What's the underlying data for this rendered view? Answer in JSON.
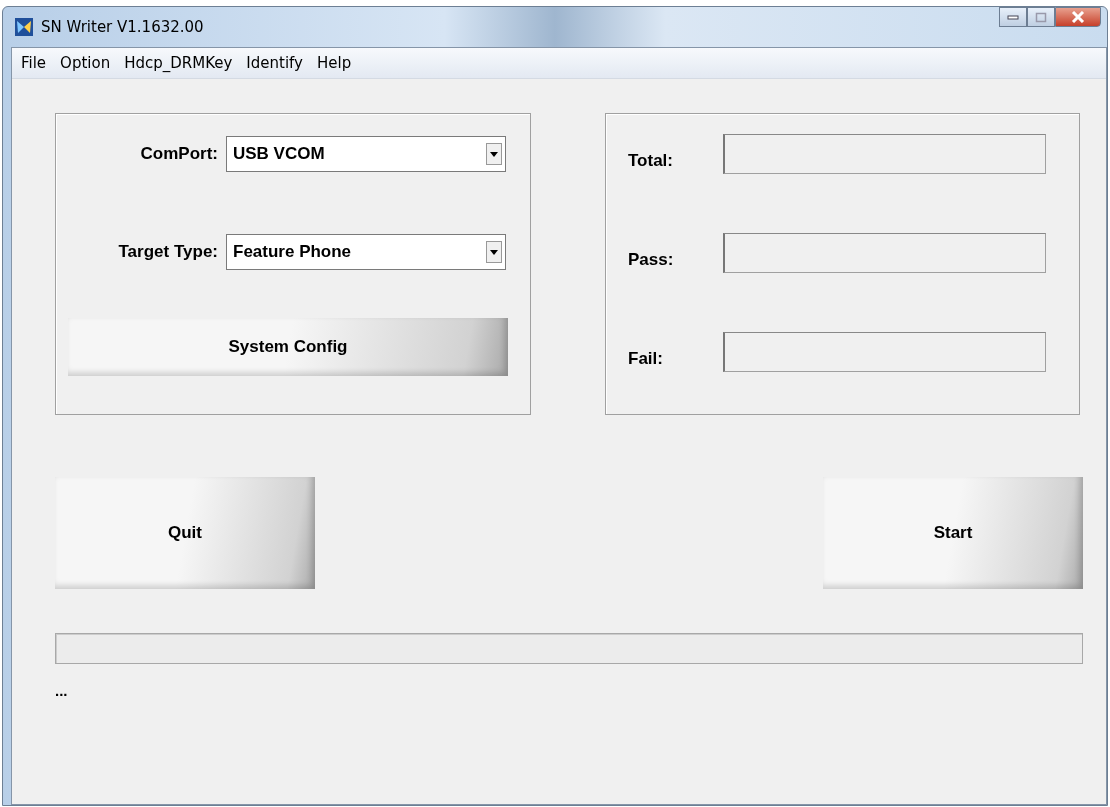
{
  "window": {
    "title": "SN Writer V1.1632.00"
  },
  "menu": [
    "File",
    "Option",
    "Hdcp_DRMKey",
    "Identify",
    "Help"
  ],
  "settings": [
    {
      "label": "ComPort:",
      "value": "USB VCOM"
    },
    {
      "label": "Target Type:",
      "value": "Feature Phone"
    }
  ],
  "config_button": "System Config",
  "counters": [
    {
      "label": "Total:"
    },
    {
      "label": "Pass:"
    },
    {
      "label": "Fail:"
    }
  ],
  "buttons": [
    {
      "label": "Quit"
    },
    {
      "label": "Start"
    }
  ],
  "progress": {
    "level": 0
  },
  "status": "..."
}
